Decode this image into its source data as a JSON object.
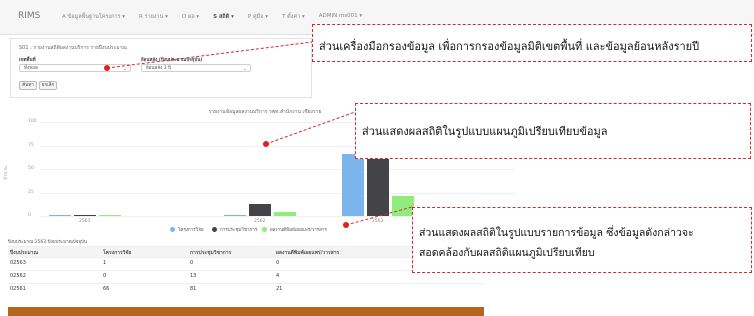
{
  "topbar": {
    "brand": "RIMS",
    "nav": [
      "A ข้อมูลพื้นฐานโครงการ ▾",
      "R รายงาน ▾",
      "O ผล ▾",
      "S สถิติ ▾",
      "P คู่มือ ▾",
      "T ตั้งค่า ▾",
      "ADMIN ms001 ▾"
    ]
  },
  "panel": {
    "title": "S01 : รายงานสถิติผลงานบริการ รายปีงบประมาณ",
    "filter1_label": "เขตพื้นที่",
    "filter1_value": "ทั้งหมด",
    "filter2_label": "ย้อนหลัง (ปีงบประมาณปัจจุบัน)",
    "filter2_value": "ย้อนหลัง 3 ปี",
    "search_btn": "ค้นหา",
    "clear_btn": "ยกเลิก"
  },
  "chart_title": "รายงานข้อมูลผลงานบริการ รพท.สำนักงาน เชียงราย",
  "axis": {
    "ylabel": "จำนวน",
    "yticks": [
      "100",
      "75",
      "50",
      "25",
      "0"
    ]
  },
  "chart_data": {
    "type": "bar",
    "categories": [
      "2561",
      "2562",
      "2563"
    ],
    "series": [
      {
        "name": "โครงการวิจัย",
        "values": [
          1,
          0,
          66
        ],
        "color": "#7cb5ec"
      },
      {
        "name": "การประชุมวิชาการ",
        "values": [
          0,
          13,
          81
        ],
        "color": "#434348"
      },
      {
        "name": "ผลงานตีพิมพ์เผยแพร่/วารสาร",
        "values": [
          0,
          4,
          21
        ],
        "color": "#90ed7d"
      }
    ],
    "ylim": [
      0,
      100
    ]
  },
  "table": {
    "title": "ปีงบประมาณ 2563 ปีงบประมาณปัจจุบัน",
    "headers": [
      "ปีงบประมาณ",
      "โครงการวิจัย",
      "การประชุมวิชาการ",
      "ผลงานตีพิมพ์เผยแพร่/วารสาร"
    ],
    "rows": [
      [
        "02563",
        "1",
        "0",
        "0"
      ],
      [
        "02562",
        "0",
        "13",
        "4"
      ],
      [
        "02561",
        "66",
        "81",
        "21"
      ]
    ]
  },
  "callouts": {
    "filter": "ส่วนเครื่องมือกรองข้อมูล เพื่อการกรองข้อมูลมิติเขตพื้นที่ และข้อมูลย้อนหลังรายปี",
    "chart": "ส่วนแสดงผลสถิติในรูปแบบแผนภูมิเปรียบเทียบข้อมูล",
    "table_line1": "ส่วนแสดงผลสถิติในรูปแบบรายการข้อมูล ซึ่งข้อมูลดังกล่าวจะ",
    "table_line2": "สอดคล้องกับผลสถิติแผนภูมิเปรียบเทียบ"
  }
}
